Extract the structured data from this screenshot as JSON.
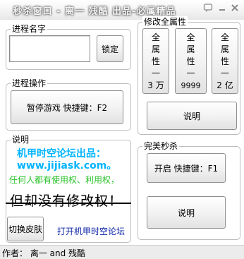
{
  "window": {
    "title": "秒杀窗口 - 离一 残酷 出品-必属精品",
    "skin_icon": "skin-icon",
    "minimize_icon": "minimize-icon",
    "close_icon": "close-icon"
  },
  "process_name": {
    "title": "进程名字",
    "input_value": "",
    "lock_label": "锁定"
  },
  "process_ops": {
    "title": "进程操作",
    "pause_label": "暂停游戏 快捷键：F2"
  },
  "modify_all": {
    "title": "修改全属性",
    "btn1_lines": [
      "全",
      "属",
      "性",
      "一",
      "3 万"
    ],
    "btn2_lines": [
      "全",
      "属",
      "性",
      "一",
      "9999"
    ],
    "btn3_lines": [
      "全",
      "属",
      "性",
      "一",
      "2 亿"
    ],
    "help_label": "说明"
  },
  "description": {
    "title": "说明",
    "line1": "机甲时空论坛出品：",
    "line2": "www.jijiask.com。",
    "line3": "任何人都有使用权、利用权，",
    "line4": "但却没有修改权！",
    "skin_label": "切换皮肤",
    "forum_link": "打开机甲时空论坛"
  },
  "perfect_kill": {
    "title": "完美秒杀",
    "start_label": "开启 快捷键：F1",
    "help_label": "说明"
  },
  "status": {
    "text": "作者： 离一 and 残酷"
  },
  "colors": {
    "cyan_text": "#00b4ff",
    "green_text": "#29c329",
    "link_text": "#0a24a8"
  }
}
